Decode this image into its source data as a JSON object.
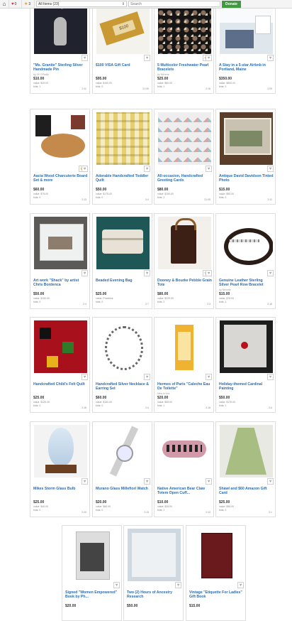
{
  "topbar": {
    "heart_count": "0",
    "star_count": "3",
    "filter_selected": "All Items (23)",
    "search_placeholder": "Search",
    "donate_label": "Donate"
  },
  "items": [
    {
      "title": "\"Ms. Granite\" Sterling Silver Handmade Pin",
      "donor": "by Jill O'Reilly",
      "price": "$10.00",
      "value": "value: $25.00",
      "bids": "bids: 1",
      "time": "2:11",
      "starred": false,
      "image": "pin"
    },
    {
      "title": "$100 VISA Gift Card",
      "donor": "",
      "price": "$95.00",
      "value": "value: $100.00",
      "bids": "bids: 0",
      "time": "21:05",
      "starred": false,
      "image": "visa"
    },
    {
      "title": "5 Multicolor Freshwater Pearl Bracelets",
      "donor": "by Nevene",
      "price": "$25.00",
      "value": "value: $80.00",
      "bids": "bids: 1",
      "time": "2:16",
      "starred": true,
      "image": "pearls"
    },
    {
      "title": "A Stay in a 5-star Airbnb in Portland, Maine",
      "donor": "",
      "price": "$350.00",
      "value": "value: $800.00",
      "bids": "bids: 0",
      "time": "2:09",
      "starred": false,
      "image": "airbnb"
    },
    {
      "title": "Aacia Wood Charcuterie Board Set & more",
      "donor": "",
      "price": "$60.00",
      "value": "value: $75.00",
      "bids": "bids: 0",
      "time": "2:13",
      "starred": true,
      "image": "board"
    },
    {
      "title": "Adorable Handcrafted Toddler Quilt",
      "donor": "",
      "price": "$50.00",
      "value": "value: $175.00",
      "bids": "bids: 0",
      "time": "2:4",
      "starred": false,
      "image": "quilt"
    },
    {
      "title": "All-occasion, Handcrafted Greeting Cards",
      "donor": "",
      "price": "$80.00",
      "value": "value: $150.00",
      "bids": "bids: 2",
      "time": "21:05",
      "starred": false,
      "image": "cards"
    },
    {
      "title": "Antique David Davidson Tinted Photo",
      "donor": "",
      "price": "$15.00",
      "value": "value: $50.00",
      "bids": "bids: 0",
      "time": "2:11",
      "starred": false,
      "image": "photo"
    },
    {
      "title": "Art work \"Shack\" by artist Chris Bordenca",
      "donor": "",
      "price": "$50.00",
      "value": "value: $150.00",
      "bids": "bids: 0",
      "time": "2:4",
      "starred": false,
      "image": "shack"
    },
    {
      "title": "Beaded Evening Bag",
      "donor": "",
      "price": "$25.00",
      "value": "value: Priceless",
      "bids": "bids: 0",
      "time": "2:7",
      "starred": false,
      "image": "bag"
    },
    {
      "title": "Dooney & Bourke Pebble Grain Tote",
      "donor": "",
      "price": "$80.00",
      "value": "value: $229.00",
      "bids": "bids: 2",
      "time": "2:3",
      "starred": true,
      "image": "tote"
    },
    {
      "title": "Genuine Leather Sterling Silver Pearl Row Bracelet",
      "donor": "by Nevene",
      "price": "$15.00",
      "value": "value: $75.00",
      "bids": "bids: 1",
      "time": "2:16",
      "starred": false,
      "image": "leather"
    },
    {
      "title": "Handcrafted Child's Felt Quilt",
      "donor": "",
      "price": "$25.00",
      "value": "value: $125.00",
      "bids": "bids: 0",
      "time": "2:18",
      "starred": false,
      "image": "felt"
    },
    {
      "title": "Handcrafted Silver Necklace & Earring Set",
      "donor": "",
      "price": "$60.00",
      "value": "value: $150.00",
      "bids": "bids: 0",
      "time": "2:4",
      "starred": false,
      "image": "necklace"
    },
    {
      "title": "Hermes of Paris \"Caleche Eau De Toilette\"",
      "donor": "New in box",
      "price": "$20.00",
      "value": "value: $95.00",
      "bids": "bids: 1",
      "time": "2:16",
      "starred": false,
      "image": "hermes"
    },
    {
      "title": "Holiday-themed Cardinal Painting",
      "donor": "",
      "price": "$50.00",
      "value": "value: $175.00",
      "bids": "bids: 1",
      "time": "2:4",
      "starred": false,
      "image": "cardinal"
    },
    {
      "title": "Mikes Storm Glass Bulb",
      "donor": "",
      "price": "$25.00",
      "value": "value: $40.00",
      "bids": "bids: 0",
      "time": "2:20",
      "starred": false,
      "image": "storm"
    },
    {
      "title": "Murano Glass Millefiori Watch",
      "donor": "",
      "price": "$20.00",
      "value": "value: $60.00",
      "bids": "bids: 0",
      "time": "2:13",
      "starred": false,
      "image": "watch"
    },
    {
      "title": "Native American Bear Claw Totem Open Cuff...",
      "donor": "",
      "price": "$10.00",
      "value": "value: $35.00",
      "bids": "bids: 1",
      "time": "2:13",
      "starred": false,
      "image": "cuff"
    },
    {
      "title": "Shawl and $60 Amazon Gift Card",
      "donor": "",
      "price": "$25.00",
      "value": "value: $95.00",
      "bids": "bids: 0",
      "time": "2:1",
      "starred": false,
      "image": "shawl"
    },
    {
      "title": "Signed \"Women Empowered\" Book by Ph...",
      "donor": "",
      "price": "$20.00",
      "value": "",
      "bids": "",
      "time": "",
      "starred": false,
      "image": "book"
    },
    {
      "title": "Two (2) Hours of Ancestry Research",
      "donor": "",
      "price": "$50.00",
      "value": "",
      "bids": "",
      "time": "",
      "starred": false,
      "image": "ancestry"
    },
    {
      "title": "Vintage \"Etiquette For Ladies\" Gift Book",
      "donor": "",
      "price": "$15.00",
      "value": "",
      "bids": "",
      "time": "",
      "starred": false,
      "image": "etiquette"
    }
  ]
}
